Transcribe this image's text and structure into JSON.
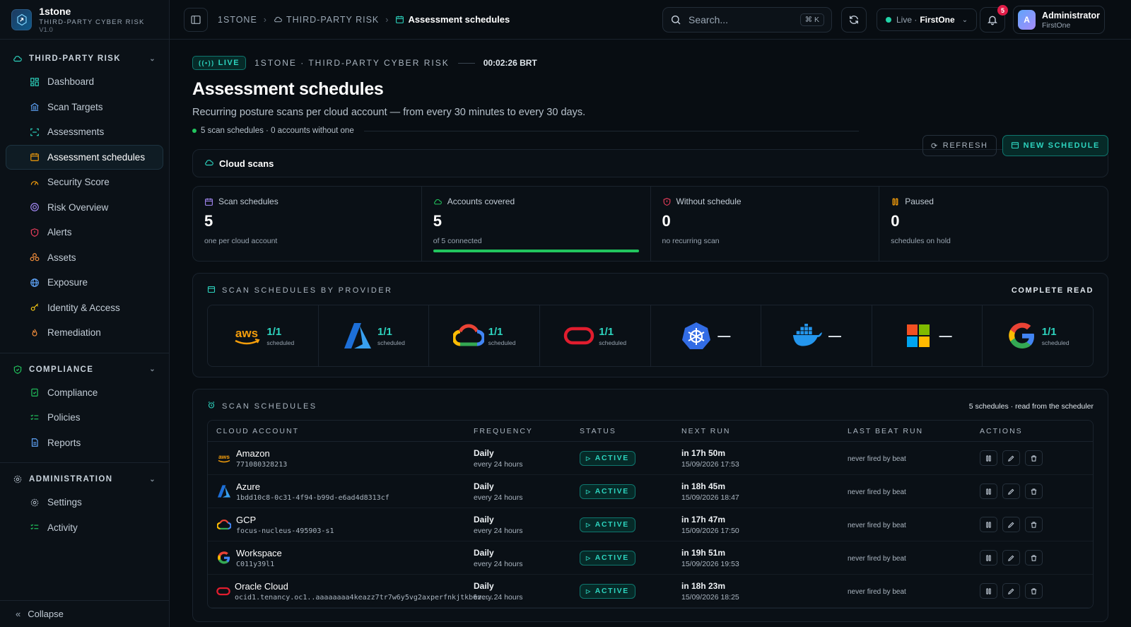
{
  "brand": {
    "name": "1stone",
    "subtitle": "THIRD-PARTY CYBER RISK",
    "version": "V1.0"
  },
  "sidebar": {
    "sections": [
      {
        "title": "THIRD-PARTY RISK",
        "items": [
          "Dashboard",
          "Scan Targets",
          "Assessments",
          "Assessment schedules",
          "Security Score",
          "Risk Overview",
          "Alerts",
          "Assets",
          "Exposure",
          "Identity & Access",
          "Remediation"
        ]
      },
      {
        "title": "COMPLIANCE",
        "items": [
          "Compliance",
          "Policies",
          "Reports"
        ]
      },
      {
        "title": "ADMINISTRATION",
        "items": [
          "Settings",
          "Activity"
        ]
      }
    ],
    "collapse_label": "Collapse"
  },
  "topbar": {
    "crumbs": [
      "1STONE",
      "THIRD-PARTY RISK",
      "Assessment schedules"
    ],
    "search_placeholder": "Search...",
    "search_kbd": "⌘ K",
    "live_label": "Live ·",
    "live_org": "FirstOne",
    "notif_count": "5",
    "user_initial": "A",
    "user_name": "Administrator",
    "user_org": "FirstOne"
  },
  "header": {
    "live_badge": "LIVE",
    "org_line": "1STONE · THIRD-PARTY CYBER RISK",
    "clock": "00:02:26 BRT",
    "title": "Assessment schedules",
    "subtitle": "Recurring posture scans per cloud account — from every 30 minutes to every 30 days.",
    "stat_line": "5 scan schedules · 0 accounts without one",
    "refresh_label": "REFRESH",
    "new_label": "NEW SCHEDULE"
  },
  "cloud_tab": "Cloud scans",
  "kpis": [
    {
      "label": "Scan schedules",
      "value": "5",
      "sub": "one per cloud account",
      "color": "#a78bfa"
    },
    {
      "label": "Accounts covered",
      "value": "5",
      "sub": "of 5 connected",
      "color": "#22c55e",
      "progress": 1.0
    },
    {
      "label": "Without schedule",
      "value": "0",
      "sub": "no recurring scan",
      "color": "#f43f5e"
    },
    {
      "label": "Paused",
      "value": "0",
      "sub": "schedules on hold",
      "color": "#f59e0b"
    }
  ],
  "providers_card": {
    "title": "SCAN SCHEDULES BY PROVIDER",
    "right": "COMPLETE READ",
    "providers": [
      {
        "name": "aws-logo",
        "ratio": "1/1",
        "label": "scheduled"
      },
      {
        "name": "azure-logo",
        "ratio": "1/1",
        "label": "scheduled"
      },
      {
        "name": "gcp-logo",
        "ratio": "1/1",
        "label": "scheduled"
      },
      {
        "name": "oracle-logo",
        "ratio": "1/1",
        "label": "scheduled"
      },
      {
        "name": "kubernetes-logo",
        "ratio": "—",
        "label": ""
      },
      {
        "name": "docker-logo",
        "ratio": "—",
        "label": ""
      },
      {
        "name": "microsoft-logo",
        "ratio": "—",
        "label": ""
      },
      {
        "name": "google-logo",
        "ratio": "1/1",
        "label": "scheduled"
      }
    ]
  },
  "schedules_card": {
    "title": "SCAN SCHEDULES",
    "right": "5 schedules · read from the scheduler",
    "columns": [
      "CLOUD ACCOUNT",
      "FREQUENCY",
      "STATUS",
      "NEXT RUN",
      "LAST BEAT RUN",
      "ACTIONS"
    ],
    "rows": [
      {
        "logo": "aws",
        "name": "Amazon",
        "id": "771080328213",
        "freq": "Daily",
        "freq_sub": "every 24 hours",
        "status": "ACTIVE",
        "next": "in 17h 50m",
        "next_date": "15/09/2026 17:53",
        "last": "never fired by beat"
      },
      {
        "logo": "azure",
        "name": "Azure",
        "id": "1bdd10c8-0c31-4f94-b99d-e6ad4d8313cf",
        "freq": "Daily",
        "freq_sub": "every 24 hours",
        "status": "ACTIVE",
        "next": "in 18h 45m",
        "next_date": "15/09/2026 18:47",
        "last": "never fired by beat"
      },
      {
        "logo": "gcp",
        "name": "GCP",
        "id": "focus-nucleus-495903-s1",
        "freq": "Daily",
        "freq_sub": "every 24 hours",
        "status": "ACTIVE",
        "next": "in 17h 47m",
        "next_date": "15/09/2026 17:50",
        "last": "never fired by beat"
      },
      {
        "logo": "google",
        "name": "Workspace",
        "id": "C011y39l1",
        "freq": "Daily",
        "freq_sub": "every 24 hours",
        "status": "ACTIVE",
        "next": "in 19h 51m",
        "next_date": "15/09/2026 19:53",
        "last": "never fired by beat"
      },
      {
        "logo": "oracle",
        "name": "Oracle Cloud",
        "id": "ocid1.tenancy.oc1..aaaaaaaa4keazz7tr7w6y5vg2axperfnkjtkb6z...",
        "freq": "Daily",
        "freq_sub": "every 24 hours",
        "status": "ACTIVE",
        "next": "in 18h 23m",
        "next_date": "15/09/2026 18:25",
        "last": "never fired by beat"
      }
    ]
  },
  "colors": {
    "accent": "#2dd4bf",
    "bg": "#080d12",
    "active": "#22c55e"
  }
}
